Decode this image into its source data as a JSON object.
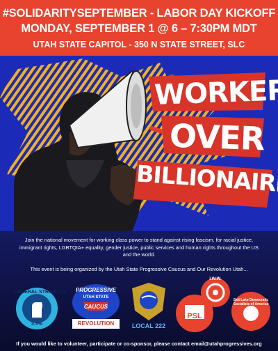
{
  "header": {
    "line1": "#SOLIDARITYSEPTEMBER - LABOR DAY KICKOFF",
    "line2": "MONDAY, SEPTEMBER 1 @ 6 – 7:30PM MDT",
    "location": "UTAH STATE CAPITOL - 350 N STATE STREET, SLC"
  },
  "slogan": {
    "line1": "WORKERS",
    "line2": "OVER",
    "line3": "BILLIONAIRES"
  },
  "body": {
    "paragraph1": "Join the national movement for working class power to stand against rising fascism, for racial justice, immigrant rights, LGBTQIA+ equality, gender justice, public services and human rights throughout the US and the world.",
    "paragraph2": "This event is being organized by the Utah State Progressive Caucus and Our Revolution Utah..."
  },
  "logos": {
    "general_strike": {
      "top": "GENERAL STRIKE U.S.",
      "bottom": "3.5%"
    },
    "progressive_caucus": {
      "line1": "PROGRESSIVE",
      "line2": "UTAH STATE",
      "line3": "CAUCUS",
      "under": "REVOLUTION"
    },
    "teamsters": {
      "label": "LOCAL 222"
    },
    "psl": {
      "center": "PSL",
      "arc": "SOCIALISM & LIBERATION PARTY FOR"
    },
    "iww": {
      "arc": "I.W.W."
    },
    "dsa": {
      "arc": "Salt Lake Democratic Socialists of America"
    }
  },
  "footer": {
    "text": "If you would like to volunteer, participate or co-sponsor, please contact email@utahprogressives.org"
  },
  "colors": {
    "header_red": "#e8432f",
    "hero_blue": "#1b2bb8",
    "stripe_yellow": "#f2b11e",
    "navy": "#0d0f3a",
    "slogan_red": "#d8342a"
  }
}
